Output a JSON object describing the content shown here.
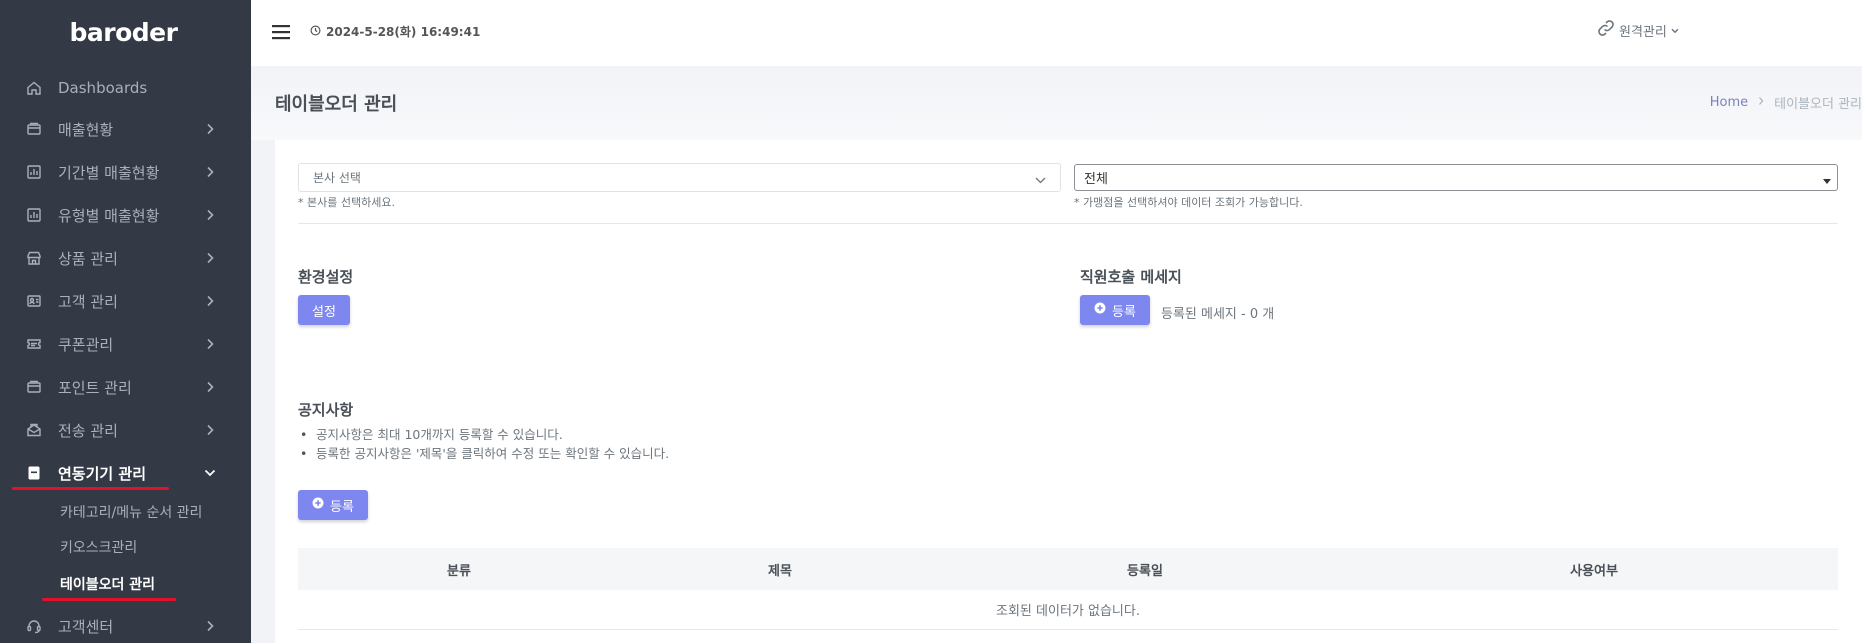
{
  "sidebar": {
    "logo": "baroder",
    "items": [
      {
        "label": "Dashboards",
        "icon": "home-icon",
        "arrow": false
      },
      {
        "label": "매출현황",
        "icon": "wallet-icon",
        "arrow": true
      },
      {
        "label": "기간별 매출현황",
        "icon": "bar-chart-icon",
        "arrow": true
      },
      {
        "label": "유형별 매출현황",
        "icon": "bar-chart-icon",
        "arrow": true
      },
      {
        "label": "상품 관리",
        "icon": "store-icon",
        "arrow": true
      },
      {
        "label": "고객 관리",
        "icon": "user-card-icon",
        "arrow": true
      },
      {
        "label": "쿠폰관리",
        "icon": "ticket-icon",
        "arrow": true
      },
      {
        "label": "포인트 관리",
        "icon": "wallet-icon",
        "arrow": true
      },
      {
        "label": "전송 관리",
        "icon": "mail-icon",
        "arrow": true
      },
      {
        "label": "연동기기 관리",
        "icon": "device-icon",
        "arrow": true,
        "expanded": true,
        "active": true
      },
      {
        "label": "고객센터",
        "icon": "headset-icon",
        "arrow": true
      }
    ],
    "sub_items": [
      {
        "label": "카테고리/메뉴 순서 관리"
      },
      {
        "label": "키오스크관리"
      },
      {
        "label": "테이블오더 관리",
        "active": true
      }
    ]
  },
  "header": {
    "datetime": "2024-5-28(화) 16:49:41",
    "remote_label": "원격관리"
  },
  "title_bar": {
    "title": "테이블오더 관리",
    "breadcrumb_home": "Home",
    "breadcrumb_current": "테이블오더 관리"
  },
  "filters": {
    "hq_select_value": "본사 선택",
    "hq_hint": "* 본사를 선택하세요.",
    "store_select_value": "전체",
    "store_hint": "* 가맹점을 선택하셔야 데이터 조회가 가능합니다."
  },
  "settings": {
    "title": "환경설정",
    "button": "설정"
  },
  "staff_call": {
    "title": "직원호출 메세지",
    "button": "등록",
    "count_text": "등록된 메세지 - 0 개"
  },
  "notice": {
    "title": "공지사항",
    "bullets": [
      "공지사항은 최대 10개까지 등록할 수 있습니다.",
      "등록한 공지사항은 '제목'을 클릭하여 수정 또는 확인할 수 있습니다."
    ],
    "button": "등록"
  },
  "table": {
    "columns": [
      "분류",
      "제목",
      "등록일",
      "사용여부"
    ],
    "empty_text": "조회된 데이터가 없습니다."
  },
  "colors": {
    "sidebar_bg": "#343a45",
    "accent_button": "#7e86ef",
    "highlight_red": "#e2122b"
  }
}
